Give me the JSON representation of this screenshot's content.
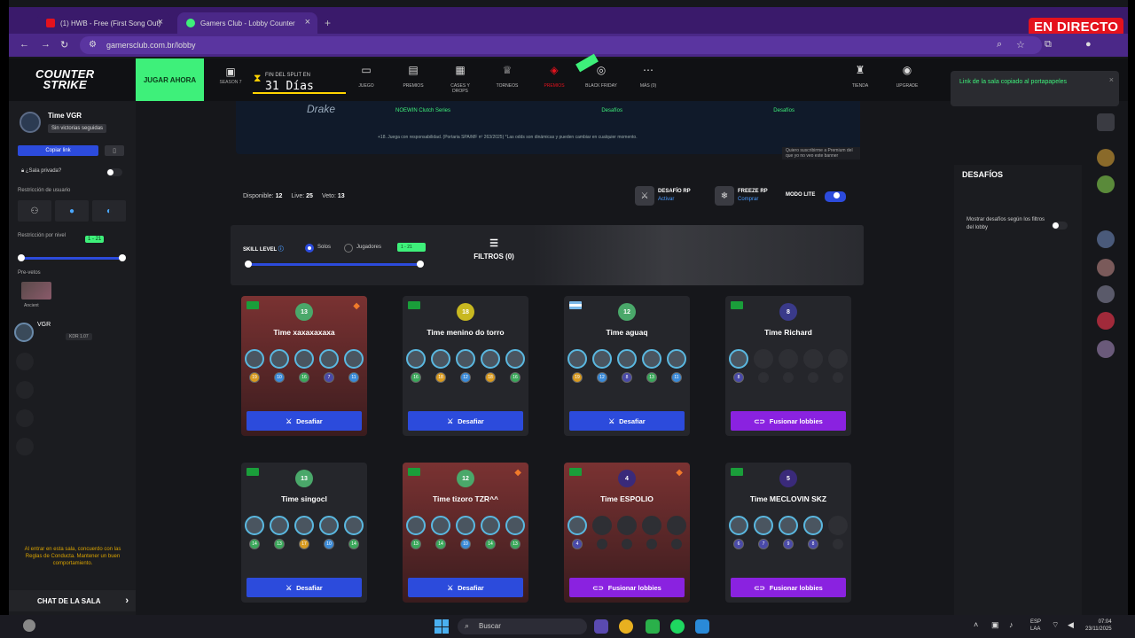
{
  "browser": {
    "tabs": [
      {
        "title": "(1) HWB - Free (First Song Out)",
        "favicon_color": "#e4121d"
      },
      {
        "title": "Gamers Club - Lobby Counter",
        "favicon_color": "#3ef07a"
      }
    ],
    "url": "gamersclub.com.br/lobby"
  },
  "overlay": {
    "live_badge": "EN DIRECTO"
  },
  "sitenav": {
    "logo": "COUNTER STRIKE",
    "play_button": "JUGAR AHORA",
    "season_label": "SEASON 7",
    "split_label": "FIN DEL SPLIT EN",
    "split_value": "31 Días",
    "items": [
      {
        "label": "JUEGO",
        "icon": "chat-icon"
      },
      {
        "label": "PREMIOS",
        "icon": "ticket-icon"
      },
      {
        "label": "CASES Y DROPS",
        "icon": "case-icon"
      },
      {
        "label": "TORNEOS",
        "icon": "trophy-icon"
      },
      {
        "label": "PREMIOS",
        "icon": "gift-icon"
      },
      {
        "label": "BLACK FRIDAY",
        "icon": "tag-icon"
      },
      {
        "label": "MÁS (0)",
        "icon": "more-icon"
      },
      {
        "label": "TIENDA",
        "icon": "store-icon"
      },
      {
        "label": "UPGRADE",
        "icon": "upgrade-icon"
      }
    ]
  },
  "toast": {
    "text": "Link de la sala copiado al portapapeles"
  },
  "sidebar": {
    "team_name": "Time VGR",
    "team_sub": "Sin victorias seguidas",
    "copy_link": "Copiar link",
    "private_label": "¿Sala privada?",
    "restriction_user": "Restricción de usuario",
    "restriction_level": "Restricción por nivel",
    "level_badge": "1 - 21",
    "pre_vetos": "Pre-vetos",
    "map_name": "Ancient",
    "member_name": "VGR",
    "member_level": "KDR 1.07",
    "rules_note": "Al entrar en esta sala, concuerdo con las Reglas de Conducta. Mantener un buen comportamiento.",
    "chat_label": "CHAT DE LA SALA"
  },
  "banner": {
    "logo": "Drake",
    "tags": [
      "NOEWIN Clutch Series",
      "Desafíos",
      "Desafíos"
    ],
    "legal": "+18. Juega con responsabilidad. (Portaria SPA/MF nº 263/2025) *Las odds son dinámicas y pueden cambiar en cualquier momento.",
    "premium_note": "Quiero suscribirme a Premium del que yo no veo este banner"
  },
  "stats": {
    "disponible_label": "Disponible:",
    "disponible": "12",
    "lives_label": "Live:",
    "lives": "25",
    "veto_label": "Veto:",
    "veto": "13"
  },
  "features": {
    "desafio_title": "DESAFÍO RP",
    "desafio_sub": "Activar",
    "freeze_title": "FREEZE RP",
    "freeze_sub": "Comprar",
    "modo_lite": "MODO LITE"
  },
  "filters": {
    "skill_level": "SKILL LEVEL",
    "solos": "Solos",
    "jugadores": "Jugadores",
    "skill_badge": "1 - 21",
    "filtros": "FILTROS (0)"
  },
  "lobbies": [
    {
      "name": "Time xaxaxaxaxa",
      "level": "13",
      "flag": "br",
      "red": true,
      "fire": true,
      "players": 5,
      "levels": [
        "19",
        "10",
        "16",
        "7",
        "11"
      ],
      "button": "Desafiar",
      "btn": "blue"
    },
    {
      "name": "Time menino do torro",
      "level": "18",
      "flag": "br",
      "red": false,
      "fire": false,
      "players": 5,
      "levels": [
        "16",
        "18",
        "12",
        "18",
        "16"
      ],
      "button": "Desafiar",
      "btn": "blue"
    },
    {
      "name": "Time aguaq",
      "level": "12",
      "flag": "ar",
      "red": false,
      "fire": false,
      "players": 5,
      "levels": [
        "19",
        "12",
        "8",
        "13",
        "11"
      ],
      "button": "Desafiar",
      "btn": "blue"
    },
    {
      "name": "Time Richard",
      "level": "8",
      "flag": "br",
      "red": false,
      "fire": false,
      "players": 1,
      "levels": [
        "8"
      ],
      "button": "Fusionar lobbies",
      "btn": "purple"
    },
    {
      "name": "Time singocl",
      "level": "13",
      "flag": "br",
      "red": false,
      "fire": false,
      "players": 5,
      "levels": [
        "14",
        "13",
        "17",
        "10",
        "14"
      ],
      "button": "Desafiar",
      "btn": "blue"
    },
    {
      "name": "Time tizoro TZR^^",
      "level": "12",
      "flag": "br",
      "red": true,
      "fire": true,
      "players": 5,
      "levels": [
        "13",
        "14",
        "10",
        "14",
        "13"
      ],
      "button": "Desafiar",
      "btn": "blue"
    },
    {
      "name": "Time ESPOLIO",
      "level": "4",
      "flag": "br",
      "red": true,
      "fire": true,
      "players": 1,
      "levels": [
        "4"
      ],
      "button": "Fusionar lobbies",
      "btn": "purple"
    },
    {
      "name": "Time MECLOVIN SKZ",
      "level": "5",
      "flag": "br",
      "red": false,
      "fire": false,
      "players": 4,
      "levels": [
        "6",
        "7",
        "9",
        "8"
      ],
      "button": "Fusionar lobbies",
      "btn": "purple"
    }
  ],
  "desafios": {
    "title": "DESAFÍOS",
    "toggle_text": "Mostrar desafíos según los filtros del lobby"
  },
  "taskbar": {
    "search": "Buscar",
    "lang": "ESP\nLAA",
    "time": "07:04",
    "date": "23/11/2025"
  }
}
